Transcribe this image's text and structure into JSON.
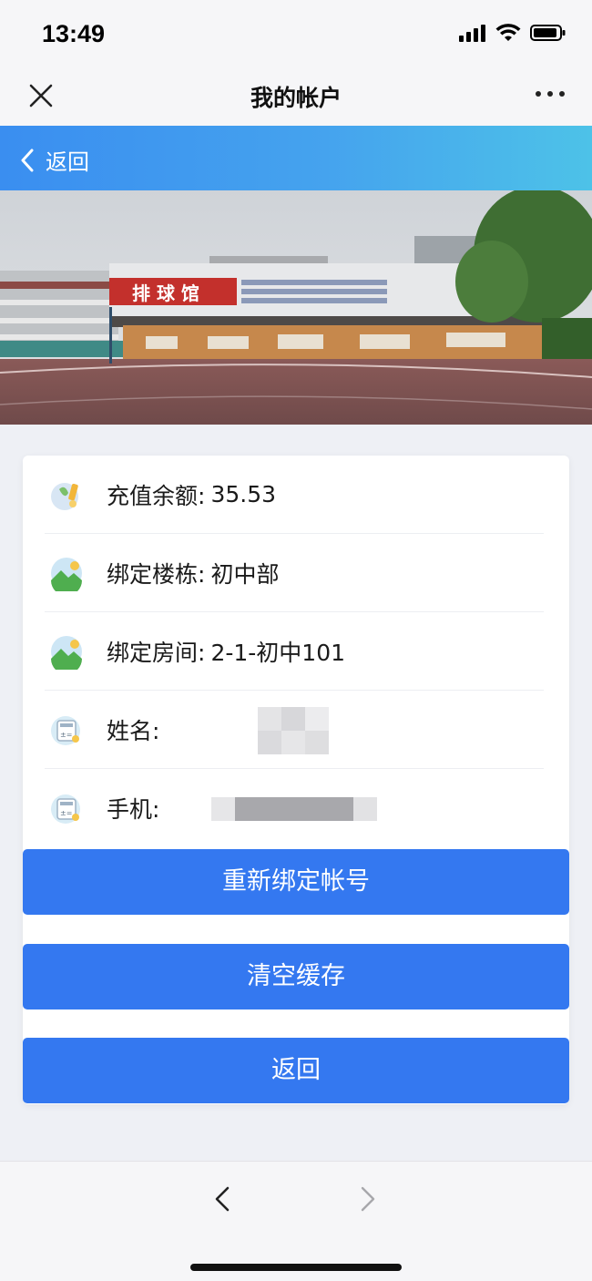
{
  "status_bar": {
    "time": "13:49"
  },
  "nav": {
    "title": "我的帐户"
  },
  "header": {
    "back_label": "返回"
  },
  "banner": {
    "sign_text": "排 球 馆"
  },
  "account": {
    "rows": [
      {
        "icon": "wallet-icon",
        "label": "充值余额:",
        "value": "35.53"
      },
      {
        "icon": "landscape-icon",
        "label": "绑定楼栋:",
        "value": "初中部"
      },
      {
        "icon": "landscape-icon",
        "label": "绑定房间:",
        "value": "2-1-初中101"
      },
      {
        "icon": "calculator-icon",
        "label": "姓名:",
        "value": ""
      },
      {
        "icon": "calculator-icon",
        "label": "手机:",
        "value": ""
      }
    ]
  },
  "buttons": {
    "rebind": "重新绑定帐号",
    "clear_cache": "清空缓存",
    "back": "返回"
  },
  "colors": {
    "button_blue": "#3478f0",
    "header_gradient_start": "#3a8ef0",
    "header_gradient_end": "#4dc2e8"
  }
}
